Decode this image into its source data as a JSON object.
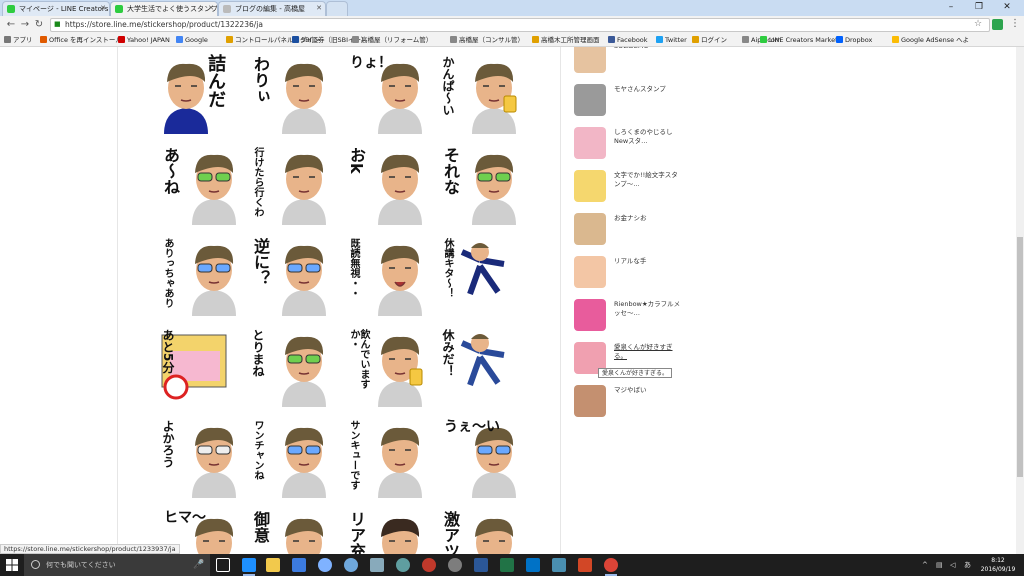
{
  "tabs": [
    {
      "title": "マイページ - LINE Creators",
      "color": "#2ecc40"
    },
    {
      "title": "大学生活でよく使うスタンプ",
      "color": "#2ecc40"
    },
    {
      "title": "ブログの編集 - 高橋屋",
      "color": "#888888"
    }
  ],
  "window_controls": {
    "minimize": "–",
    "maximize": "❐",
    "close": "✕"
  },
  "toolbar": {
    "back": "←",
    "forward": "→",
    "reload": "↻",
    "url": "https://store.line.me/stickershop/product/1322236/ja",
    "star": "☆",
    "menu": "⋮"
  },
  "bookmarks": [
    {
      "label": "アプリ",
      "color": "#777777"
    },
    {
      "label": "Office を再インストール",
      "color": "#e05a00"
    },
    {
      "label": "Yahoo! JAPAN",
      "color": "#d00000"
    },
    {
      "label": "Google",
      "color": "#4285f4"
    },
    {
      "label": "コントロールパネルログイン",
      "color": "#e0a000"
    },
    {
      "label": "SBI証券（旧SBIイー）",
      "color": "#1b4fa0"
    },
    {
      "label": "高橋屋（リフォーム管）",
      "color": "#888888"
    },
    {
      "label": "高橋屋（コンサル管）",
      "color": "#888888"
    },
    {
      "label": "高橋木工所管理画面",
      "color": "#e0a000"
    },
    {
      "label": "Facebook",
      "color": "#3b5998"
    },
    {
      "label": "Twitter",
      "color": "#1da1f2"
    },
    {
      "label": "ログイン",
      "color": "#e0a000"
    },
    {
      "label": "Aipo.com",
      "color": "#888888"
    },
    {
      "label": "LINE Creators Market",
      "color": "#2ecc40"
    },
    {
      "label": "Dropbox",
      "color": "#0061fe"
    },
    {
      "label": "Google AdSense へよ",
      "color": "#fbbc05"
    }
  ],
  "stickers": [
    {
      "text": "詰んだ",
      "style": "vertical-right",
      "variant": "suit"
    },
    {
      "text": "わりぃ",
      "style": "vertical-left",
      "variant": "plain"
    },
    {
      "text": "りょ！",
      "style": "top",
      "variant": "plain"
    },
    {
      "text": "かんぱ〜い",
      "style": "vertical-left",
      "variant": "beer"
    },
    {
      "text": "あ〜ね",
      "style": "vertical-left",
      "variant": "green-glasses"
    },
    {
      "text": "行けたら行くわ",
      "style": "vertical-left",
      "variant": "plain"
    },
    {
      "text": "おk",
      "style": "vertical-left",
      "variant": "plain"
    },
    {
      "text": "それな",
      "style": "vertical-left",
      "variant": "green-glasses"
    },
    {
      "text": "ありっちゃあり",
      "style": "vertical-left",
      "variant": "blue-glasses"
    },
    {
      "text": "逆に？",
      "style": "vertical-left",
      "variant": "blue-glasses"
    },
    {
      "text": "既読無視・・",
      "style": "vertical-left",
      "variant": "laugh"
    },
    {
      "text": "休講キタ〜！",
      "style": "vertical-left",
      "variant": "dance"
    },
    {
      "text": "あと5分",
      "style": "vertical-left",
      "variant": "sleep"
    },
    {
      "text": "とりまね",
      "style": "vertical-left",
      "variant": "green-glasses"
    },
    {
      "text": "飲んでいますか・",
      "style": "vertical-left",
      "variant": "beer"
    },
    {
      "text": "休みだ！",
      "style": "vertical-left",
      "variant": "run"
    },
    {
      "text": "よかろう",
      "style": "vertical-left",
      "variant": "white-glasses"
    },
    {
      "text": "ワンチャンね",
      "style": "vertical-left",
      "variant": "blue-glasses"
    },
    {
      "text": "サンキューです",
      "style": "vertical-left",
      "variant": "plain"
    },
    {
      "text": "うぇ〜い",
      "style": "top",
      "variant": "blue-glasses"
    },
    {
      "text": "ヒマ〜",
      "style": "top",
      "variant": "plain"
    },
    {
      "text": "御意",
      "style": "vertical-left",
      "variant": "plain"
    },
    {
      "text": "リア充",
      "style": "vertical-left",
      "variant": "dark"
    },
    {
      "text": "激アツ",
      "style": "vertical-left",
      "variant": "plain"
    }
  ],
  "related": [
    {
      "title": "SOLIDEMO"
    },
    {
      "title": "モヤさんスタンプ"
    },
    {
      "title": "しろくまのやじるし Newスタ…"
    },
    {
      "title": "文字でか!!絵文字スタンプ〜…"
    },
    {
      "title": "お金ナシお"
    },
    {
      "title": "リアルな手"
    },
    {
      "title": "Rienbow★カラフルメッセ〜…"
    },
    {
      "title": "愛泉くんが好きすぎる。"
    },
    {
      "title": "マジやばい"
    }
  ],
  "tooltip": "愛泉くんが好きすぎる。",
  "status_url": "https://store.line.me/stickershop/product/1233937/ja",
  "taskbar": {
    "search_placeholder": "何でも聞いてください",
    "time": "8:12",
    "date": "2016/09/19"
  },
  "colors": {
    "accent_line": "#2ecc40",
    "hair": "#6b5a3a",
    "skin": "#e8b48a"
  }
}
